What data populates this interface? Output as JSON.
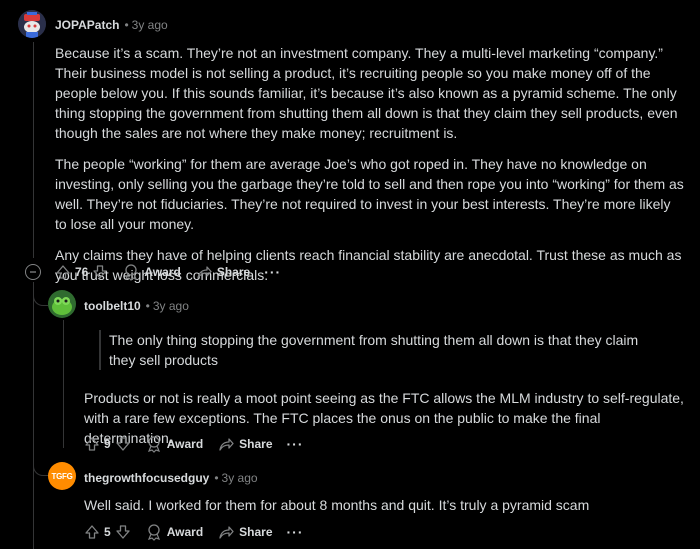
{
  "comments": [
    {
      "user": "JOPAPatch",
      "time": "3y ago",
      "paragraphs": [
        "Because it’s a scam. They’re not an investment company. They a multi-level marketing “company.” Their business model is not selling a product, it’s recruiting people so you make money off of the people below you. If this sounds familiar, it’s because it’s also known as a pyramid scheme. The only thing stopping the government from shutting them all down is that they claim they sell products, even though the sales are not where they make money; recruitment is.",
        "The people “working” for them are average Joe’s who got roped in. They have no knowledge on investing, only selling you the garbage they’re told to sell and then rope you into “working” for them as well. They’re not fiduciaries. They’re not required to invest in your best interests. They’re more likely to lose all your money.",
        "Any claims they have of helping clients reach financial stability are anecdotal. Trust these as much as you trust weight loss commercials."
      ],
      "score": "76",
      "award_label": "Award",
      "share_label": "Share",
      "more_label": "···"
    },
    {
      "user": "toolbelt10",
      "time": "3y ago",
      "quote": "The only thing stopping the government from shutting them all down is that they claim they sell products",
      "paragraphs": [
        "Products or not is really a moot point seeing as the FTC allows the MLM industry to self-regulate, with a rare few exceptions. The FTC places the onus on the public to make the final determination."
      ],
      "score": "9",
      "award_label": "Award",
      "share_label": "Share",
      "more_label": "···"
    },
    {
      "user": "thegrowthfocusedguy",
      "time": "3y ago",
      "avatar_text": "TGFG",
      "paragraphs": [
        "Well said. I worked for them for about 8 months and quit. It’s truly a pyramid scam"
      ],
      "score": "5",
      "award_label": "Award",
      "share_label": "Share",
      "more_label": "···"
    }
  ],
  "colors": {
    "background": "#000000",
    "text": "#d7dadc",
    "meta": "#818384",
    "thread_line": "#343536",
    "avatar3_bg": "#ff8c00"
  }
}
